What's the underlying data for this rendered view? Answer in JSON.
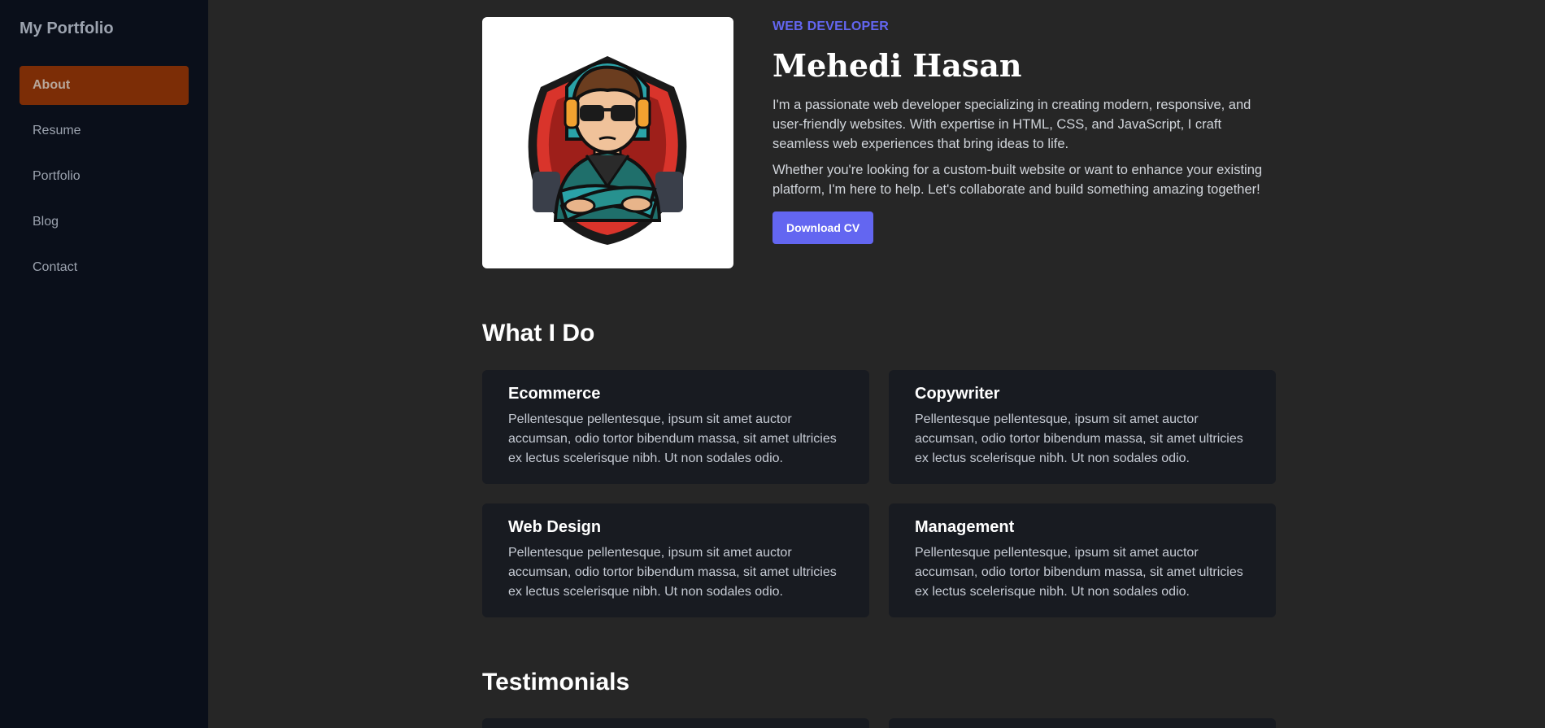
{
  "sidebar": {
    "brand": "My Portfolio",
    "items": [
      {
        "label": "About",
        "active": true
      },
      {
        "label": "Resume",
        "active": false
      },
      {
        "label": "Portfolio",
        "active": false
      },
      {
        "label": "Blog",
        "active": false
      },
      {
        "label": "Contact",
        "active": false
      }
    ]
  },
  "hero": {
    "avatar_icon": "gamer-avatar-illustration",
    "eyebrow": "WEB DEVELOPER",
    "name": "Mehedi Hasan",
    "paragraphs": [
      "I'm a passionate web developer specializing in creating modern, responsive, and user-friendly websites. With expertise in HTML, CSS, and JavaScript, I craft seamless web experiences that bring ideas to life.",
      "Whether you're looking for a custom-built website or want to enhance your existing platform, I'm here to help. Let's collaborate and build something amazing together!"
    ],
    "cta_label": "Download CV"
  },
  "services": {
    "title": "What I Do",
    "items": [
      {
        "title": "Ecommerce",
        "text": "Pellentesque pellentesque, ipsum sit amet auctor accumsan, odio tortor bibendum massa, sit amet ultricies ex lectus scelerisque nibh. Ut non sodales odio."
      },
      {
        "title": "Copywriter",
        "text": "Pellentesque pellentesque, ipsum sit amet auctor accumsan, odio tortor bibendum massa, sit amet ultricies ex lectus scelerisque nibh. Ut non sodales odio."
      },
      {
        "title": "Web Design",
        "text": "Pellentesque pellentesque, ipsum sit amet auctor accumsan, odio tortor bibendum massa, sit amet ultricies ex lectus scelerisque nibh. Ut non sodales odio."
      },
      {
        "title": "Management",
        "text": "Pellentesque pellentesque, ipsum sit amet auctor accumsan, odio tortor bibendum massa, sit amet ultricies ex lectus scelerisque nibh. Ut non sodales odio."
      }
    ]
  },
  "testimonials": {
    "title": "Testimonials"
  },
  "colors": {
    "page_bg": "#262626",
    "sidebar_bg": "#0a0f1a",
    "active_nav_bg": "#7c2d06",
    "accent": "#6366f1",
    "card_bg": "#181b21"
  }
}
